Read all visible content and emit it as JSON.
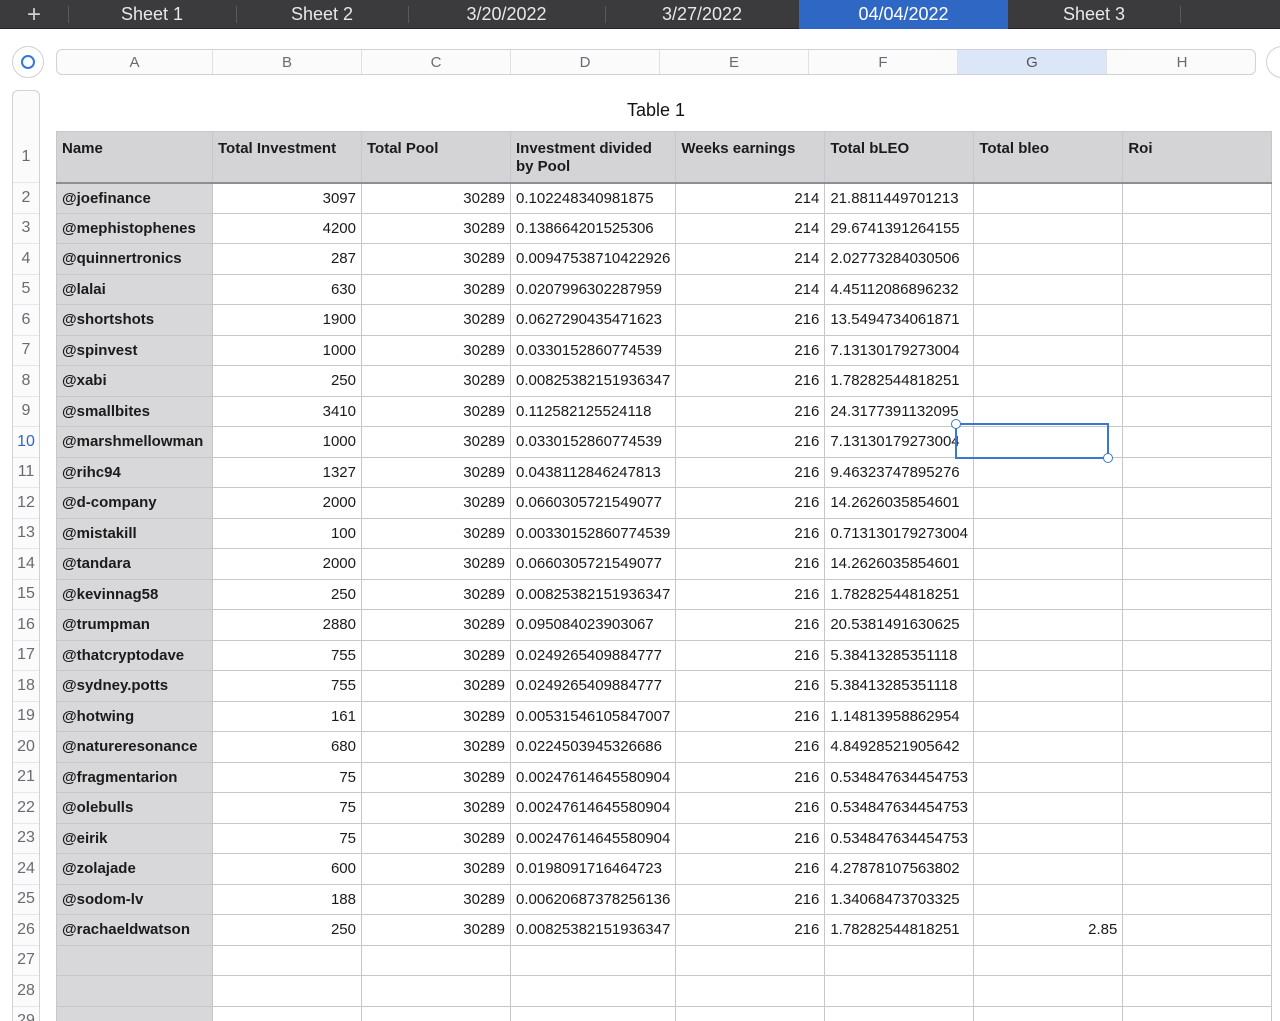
{
  "tabs": [
    {
      "label": "+"
    },
    {
      "label": "Sheet 1"
    },
    {
      "label": "Sheet 2"
    },
    {
      "label": "3/20/2022"
    },
    {
      "label": "3/27/2022"
    },
    {
      "label": "04/04/2022",
      "active": true
    },
    {
      "label": "Sheet 3"
    }
  ],
  "column_letters": [
    "A",
    "B",
    "C",
    "D",
    "E",
    "F",
    "G",
    "H"
  ],
  "selected_column": "G",
  "selected_row": "10",
  "table_title": "Table 1",
  "headers": [
    "Name",
    "Total Investment",
    "Total Pool",
    "Investment divided by Pool",
    "Weeks earnings",
    "Total bLEO",
    "Total bleo",
    "Roi"
  ],
  "rows": [
    [
      "@joefinance",
      "3097",
      "30289",
      "0.102248340981875",
      "214",
      "21.8811449701213",
      "",
      ""
    ],
    [
      "@mephistophenes",
      "4200",
      "30289",
      "0.138664201525306",
      "214",
      "29.6741391264155",
      "",
      ""
    ],
    [
      "@quinnertronics",
      "287",
      "30289",
      "0.00947538710422926",
      "214",
      "2.02773284030506",
      "",
      ""
    ],
    [
      "@lalai",
      "630",
      "30289",
      "0.0207996302287959",
      "214",
      "4.45112086896232",
      "",
      ""
    ],
    [
      "@shortshots",
      "1900",
      "30289",
      "0.0627290435471623",
      "216",
      "13.5494734061871",
      "",
      ""
    ],
    [
      "@spinvest",
      "1000",
      "30289",
      "0.0330152860774539",
      "216",
      "7.13130179273004",
      "",
      ""
    ],
    [
      "@xabi",
      "250",
      "30289",
      "0.00825382151936347",
      "216",
      "1.78282544818251",
      "",
      ""
    ],
    [
      "@smallbites",
      "3410",
      "30289",
      "0.112582125524118",
      "216",
      "24.3177391132095",
      "",
      ""
    ],
    [
      "@marshmellowman",
      "1000",
      "30289",
      "0.0330152860774539",
      "216",
      "7.13130179273004",
      "",
      ""
    ],
    [
      "@rihc94",
      "1327",
      "30289",
      "0.0438112846247813",
      "216",
      "9.46323747895276",
      "",
      ""
    ],
    [
      "@d-company",
      "2000",
      "30289",
      "0.0660305721549077",
      "216",
      "14.2626035854601",
      "",
      ""
    ],
    [
      "@mistakill",
      "100",
      "30289",
      "0.00330152860774539",
      "216",
      "0.713130179273004",
      "",
      ""
    ],
    [
      "@tandara",
      "2000",
      "30289",
      "0.0660305721549077",
      "216",
      "14.2626035854601",
      "",
      ""
    ],
    [
      "@kevinnag58",
      "250",
      "30289",
      "0.00825382151936347",
      "216",
      "1.78282544818251",
      "",
      ""
    ],
    [
      "@trumpman",
      "2880",
      "30289",
      "0.095084023903067",
      "216",
      "20.5381491630625",
      "",
      ""
    ],
    [
      "@thatcryptodave",
      "755",
      "30289",
      "0.0249265409884777",
      "216",
      "5.38413285351118",
      "",
      ""
    ],
    [
      "@sydney.potts",
      "755",
      "30289",
      "0.0249265409884777",
      "216",
      "5.38413285351118",
      "",
      ""
    ],
    [
      "@hotwing",
      "161",
      "30289",
      "0.00531546105847007",
      "216",
      "1.14813958862954",
      "",
      ""
    ],
    [
      "@natureresonance",
      "680",
      "30289",
      "0.0224503945326686",
      "216",
      "4.84928521905642",
      "",
      ""
    ],
    [
      "@fragmentarion",
      "75",
      "30289",
      "0.00247614645580904",
      "216",
      "0.534847634454753",
      "",
      ""
    ],
    [
      "@olebulls",
      "75",
      "30289",
      "0.00247614645580904",
      "216",
      "0.534847634454753",
      "",
      ""
    ],
    [
      "@eirik",
      "75",
      "30289",
      "0.00247614645580904",
      "216",
      "0.534847634454753",
      "",
      ""
    ],
    [
      "@zolajade",
      "600",
      "30289",
      "0.0198091716464723",
      "216",
      "4.27878107563802",
      "",
      ""
    ],
    [
      "@sodom-lv",
      "188",
      "30289",
      "0.00620687378256136",
      "216",
      "1.34068473703325",
      "",
      ""
    ],
    [
      "@rachaeldwatson",
      "250",
      "30289",
      "0.00825382151936347",
      "216",
      "1.78282544818251",
      "2.85",
      ""
    ],
    [
      "",
      "",
      "",
      "",
      "",
      "",
      "",
      ""
    ],
    [
      "",
      "",
      "",
      "",
      "",
      "",
      "",
      ""
    ],
    [
      "",
      "",
      "",
      "",
      "",
      "",
      "",
      ""
    ]
  ],
  "row_numbers": [
    "1",
    "2",
    "3",
    "4",
    "5",
    "6",
    "7",
    "8",
    "9",
    "10",
    "11",
    "12",
    "13",
    "14",
    "15",
    "16",
    "17",
    "18",
    "19",
    "20",
    "21",
    "22",
    "23",
    "24",
    "25",
    "26",
    "27",
    "28",
    "29"
  ],
  "colors": {
    "tab_bar": "#3b3b3d",
    "active_tab": "#2f67c5",
    "header_fill": "#d4d4d6",
    "selection": "#3a78cf"
  }
}
